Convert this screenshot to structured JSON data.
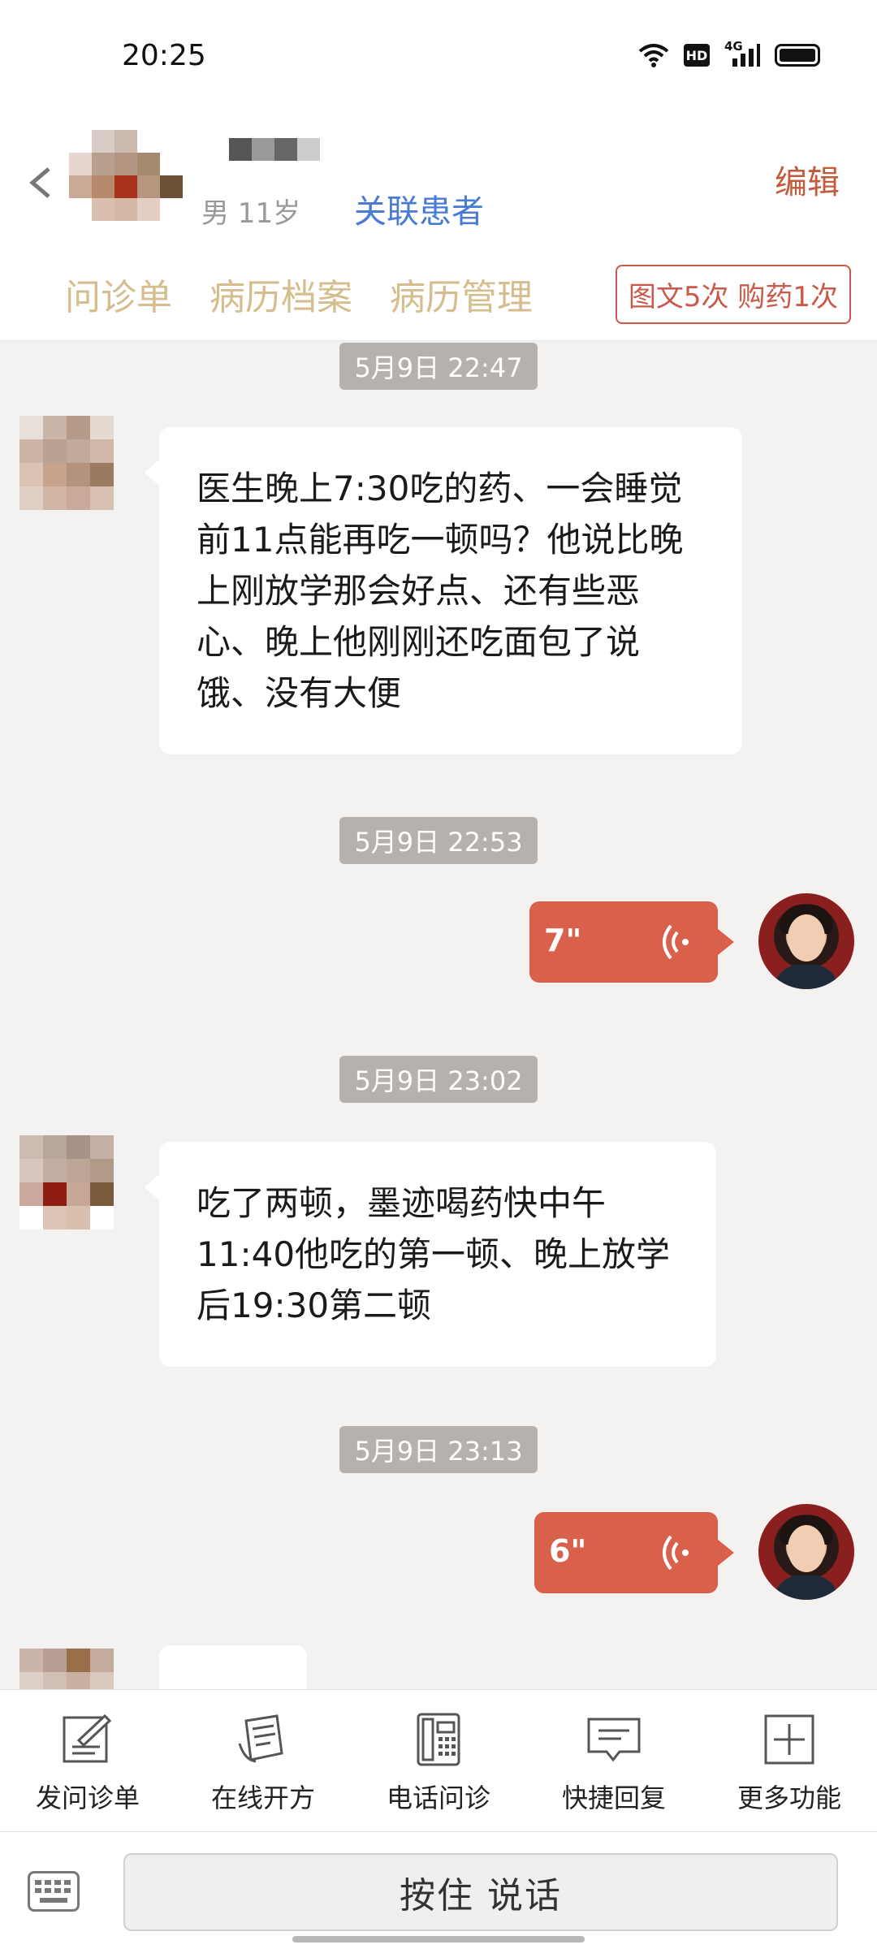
{
  "status_bar": {
    "time": "20:25",
    "hd_label": "HD",
    "network": "4G"
  },
  "header": {
    "gender_age": "男 11岁",
    "link_patient_label": "关联患者",
    "edit_label": "编辑",
    "tabs": [
      {
        "label": "问诊单"
      },
      {
        "label": "病历档案"
      },
      {
        "label": "病历管理"
      }
    ],
    "quota_label": "图文5次 购药1次"
  },
  "messages": [
    {
      "type": "timestamp",
      "text": "5月9日 22:47"
    },
    {
      "type": "patient_text",
      "text": "医生晚上7:30吃的药、一会睡觉前11点能再吃一顿吗？他说比晚上刚放学那会好点、还有些恶心、晚上他刚刚还吃面包了说饿、没有大便"
    },
    {
      "type": "timestamp",
      "text": "5月9日 22:53"
    },
    {
      "type": "doctor_voice",
      "duration": "7\""
    },
    {
      "type": "timestamp",
      "text": "5月9日 23:02"
    },
    {
      "type": "patient_text",
      "text": "吃了两顿，墨迹喝药快中午11:40他吃的第一顿、晚上放学后19:30第二顿"
    },
    {
      "type": "timestamp",
      "text": "5月9日 23:13"
    },
    {
      "type": "doctor_voice",
      "duration": "6\""
    }
  ],
  "toolbar": {
    "items": [
      {
        "label": "发问诊单",
        "icon": "form-pen-icon"
      },
      {
        "label": "在线开方",
        "icon": "prescription-icon"
      },
      {
        "label": "电话问诊",
        "icon": "phone-icon"
      },
      {
        "label": "快捷回复",
        "icon": "chat-bubble-icon"
      },
      {
        "label": "更多功能",
        "icon": "plus-box-icon"
      }
    ]
  },
  "input_bar": {
    "hold_to_talk_label": "按住 说话"
  },
  "colors": {
    "accent": "#c9594a",
    "voice_bubble": "#d9614b",
    "tab_text": "#d5bd8e",
    "link": "#4a7bd4"
  }
}
